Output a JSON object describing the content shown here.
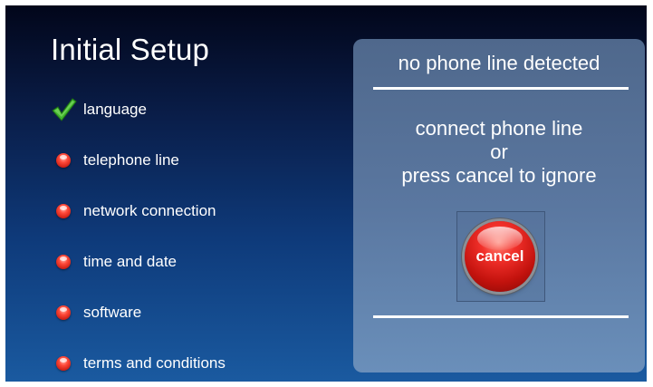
{
  "header": {
    "title": "Initial Setup"
  },
  "steps": [
    {
      "label": "language",
      "status": "done",
      "icon": "checkmark-icon"
    },
    {
      "label": "telephone line",
      "status": "pending",
      "icon": "red-dot-icon"
    },
    {
      "label": "network connection",
      "status": "pending",
      "icon": "red-dot-icon"
    },
    {
      "label": "time and date",
      "status": "pending",
      "icon": "red-dot-icon"
    },
    {
      "label": "software",
      "status": "pending",
      "icon": "red-dot-icon"
    },
    {
      "label": "terms and conditions",
      "status": "pending",
      "icon": "red-dot-icon"
    }
  ],
  "panel": {
    "heading": "no phone line detected",
    "message": {
      "line1": "connect phone line",
      "line2": "or",
      "line3": "press cancel to ignore"
    },
    "cancel_label": "cancel"
  },
  "colors": {
    "check": "#3fb52e",
    "pending": "#e8281c",
    "panel": "#5a77a0"
  }
}
